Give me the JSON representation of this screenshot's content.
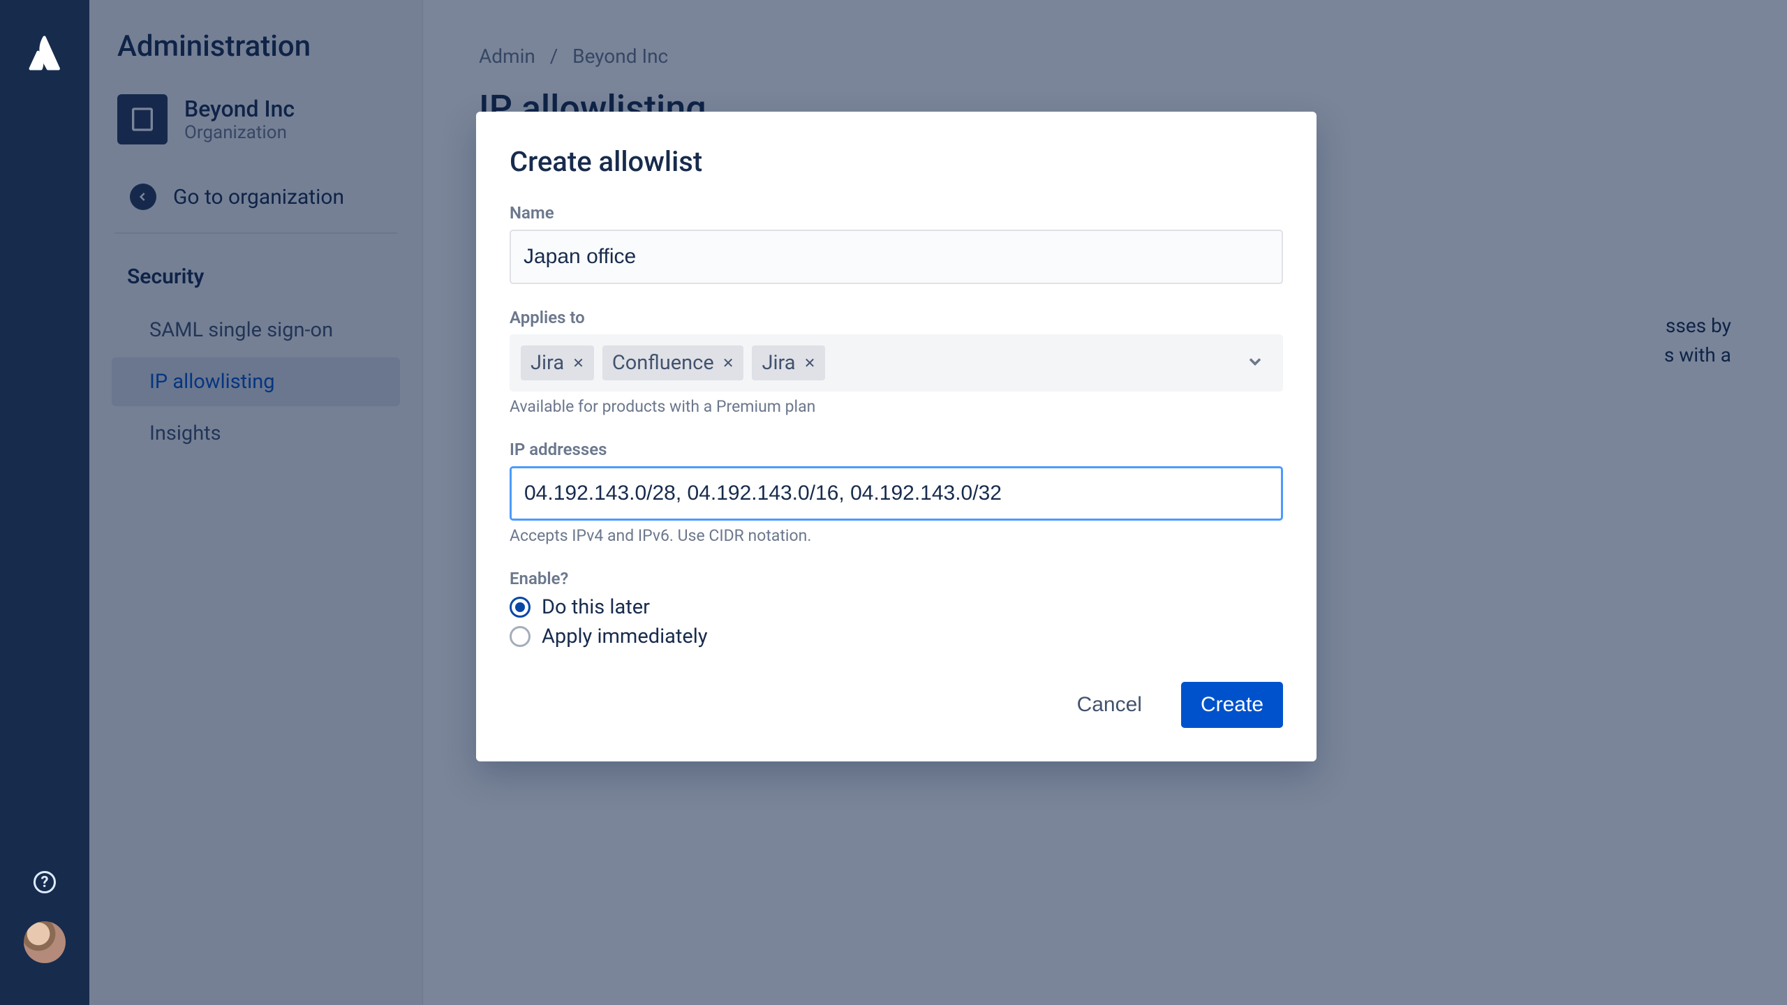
{
  "rail": {
    "help_tooltip": "Help",
    "avatar_alt": "User avatar"
  },
  "sidebar": {
    "title": "Administration",
    "org_name": "Beyond Inc",
    "org_sub": "Organization",
    "go_label": "Go to organization",
    "section_label": "Security",
    "items": [
      {
        "label": "SAML single sign-on",
        "active": false
      },
      {
        "label": "IP allowlisting",
        "active": true
      },
      {
        "label": "Insights",
        "active": false
      }
    ]
  },
  "breadcrumb": {
    "root": "Admin",
    "sep": "/",
    "org": "Beyond Inc"
  },
  "page": {
    "title": "IP allowlisting",
    "blurb_tail_1": "sses by",
    "blurb_tail_2": "s with a"
  },
  "modal": {
    "title": "Create allowlist",
    "name_label": "Name",
    "name_value": "Japan office",
    "applies_label": "Applies to",
    "applies_help": "Available for products with a Premium plan",
    "applies_tags": [
      "Jira",
      "Confluence",
      "Jira"
    ],
    "ips_label": "IP addresses",
    "ips_value": "04.192.143.0/28, 04.192.143.0/16, 04.192.143.0/32",
    "ips_help": "Accepts IPv4 and IPv6. Use CIDR notation.",
    "enable_label": "Enable?",
    "enable_options": [
      {
        "label": "Do this later",
        "selected": true
      },
      {
        "label": "Apply immediately",
        "selected": false
      }
    ],
    "cancel": "Cancel",
    "create": "Create"
  }
}
